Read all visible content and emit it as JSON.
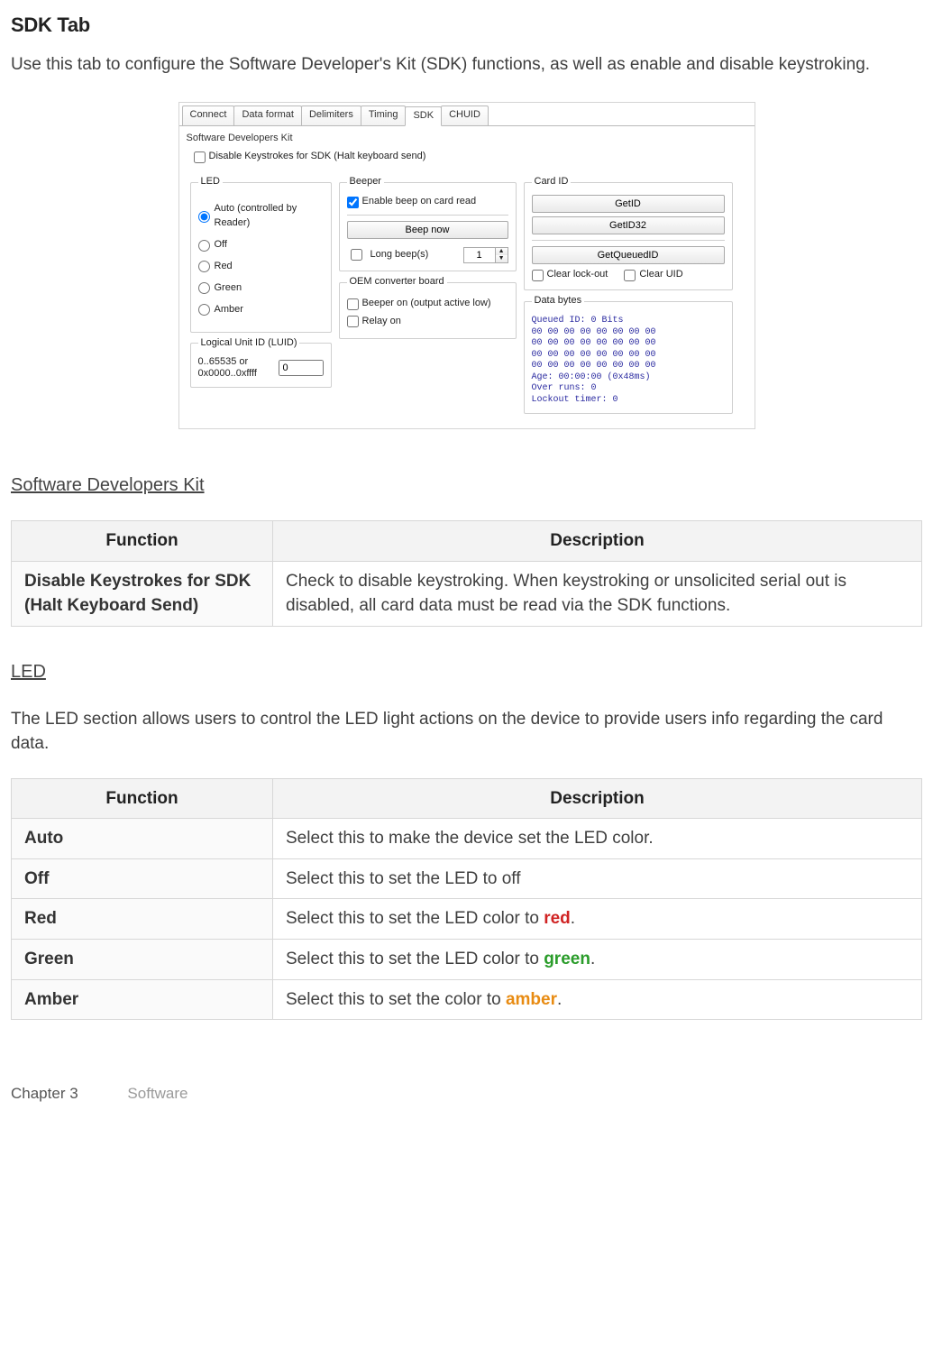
{
  "title": "SDK Tab",
  "intro": "Use this tab to configure the Software Developer's Kit (SDK) functions, as well as enable and disable keystroking.",
  "screenshot": {
    "tabs": [
      "Connect",
      "Data format",
      "Delimiters",
      "Timing",
      "SDK",
      "CHUID"
    ],
    "group_title": "Software Developers Kit",
    "disable_keystrokes_label": "Disable Keystrokes for SDK (Halt keyboard send)",
    "led": {
      "legend": "LED",
      "options": [
        "Auto (controlled by Reader)",
        "Off",
        "Red",
        "Green",
        "Amber"
      ]
    },
    "luid": {
      "legend": "Logical Unit ID (LUID)",
      "range": "0..65535 or 0x0000..0xffff",
      "value": "0"
    },
    "beeper": {
      "legend": "Beeper",
      "enable_label": "Enable beep on card read",
      "beep_now": "Beep now",
      "long_beep_label": "Long beep(s)",
      "long_beep_value": "1"
    },
    "oem": {
      "legend": "OEM converter board",
      "beeper_on": "Beeper on (output active low)",
      "relay_on": "Relay on"
    },
    "cardid": {
      "legend": "Card ID",
      "buttons": [
        "GetID",
        "GetID32",
        "GetQueuedID"
      ],
      "clear_lockout": "Clear lock-out",
      "clear_uid": "Clear UID"
    },
    "databytes": {
      "legend": "Data bytes",
      "dump": "Queued ID: 0 Bits\n00 00 00 00 00 00 00 00\n00 00 00 00 00 00 00 00\n00 00 00 00 00 00 00 00\n00 00 00 00 00 00 00 00\nAge: 00:00:00 (0x48ms)\nOver runs: 0\nLockout timer: 0"
    }
  },
  "sec_sdk_title": "Software Developers Kit",
  "table_sdk": {
    "headers": [
      "Function",
      "Description"
    ],
    "rows": [
      {
        "fn": "Disable Keystrokes for SDK (Halt Keyboard Send)",
        "desc": "Check to disable keystroking. When keystroking or unsolicited serial out is disabled, all card data must be read via the SDK functions."
      }
    ]
  },
  "sec_led_title": "LED",
  "led_intro": "The LED section allows users to control the LED light actions on the device to provide users info regarding the card data.",
  "table_led": {
    "headers": [
      "Function",
      "Description"
    ],
    "rows": {
      "auto": {
        "fn": "Auto",
        "desc": "Select this to make the device set the LED color."
      },
      "off": {
        "fn": "Off",
        "desc": "Select this to set the LED to off"
      },
      "red": {
        "fn": "Red",
        "d1": "Select this to set the LED color to ",
        "kw": "red",
        "d2": "."
      },
      "green": {
        "fn": "Green",
        "d1": "Select this to set the LED color to ",
        "kw": "green",
        "d2": "."
      },
      "amber": {
        "fn": "Amber",
        "d1": "Select this to set the color to ",
        "kw": "amber",
        "d2": "."
      }
    }
  },
  "footer": {
    "chapter": "Chapter 3",
    "section": "Software"
  }
}
